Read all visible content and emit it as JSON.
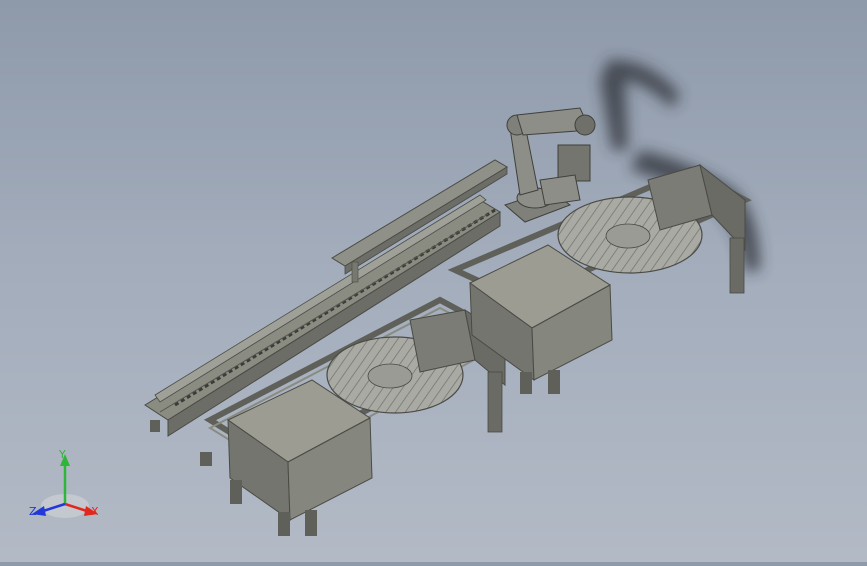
{
  "viewer": {
    "background_top": "#8e99aa",
    "background_bottom": "#b3bac6"
  },
  "model": {
    "colors": {
      "frame": "#8a8b81",
      "frame_dark": "#5f605a",
      "box_top": "#9c9c92",
      "box_side": "#74756e",
      "box_front": "#85867e",
      "turntable": "#a9aaa3",
      "robot": "#8e8e88",
      "shadow": "#2e3238"
    }
  },
  "triad": {
    "x_label": "X",
    "y_label": "Y",
    "z_label": "Z",
    "x_color": "#e0281e",
    "y_color": "#2fb53a",
    "z_color": "#2238d8"
  }
}
